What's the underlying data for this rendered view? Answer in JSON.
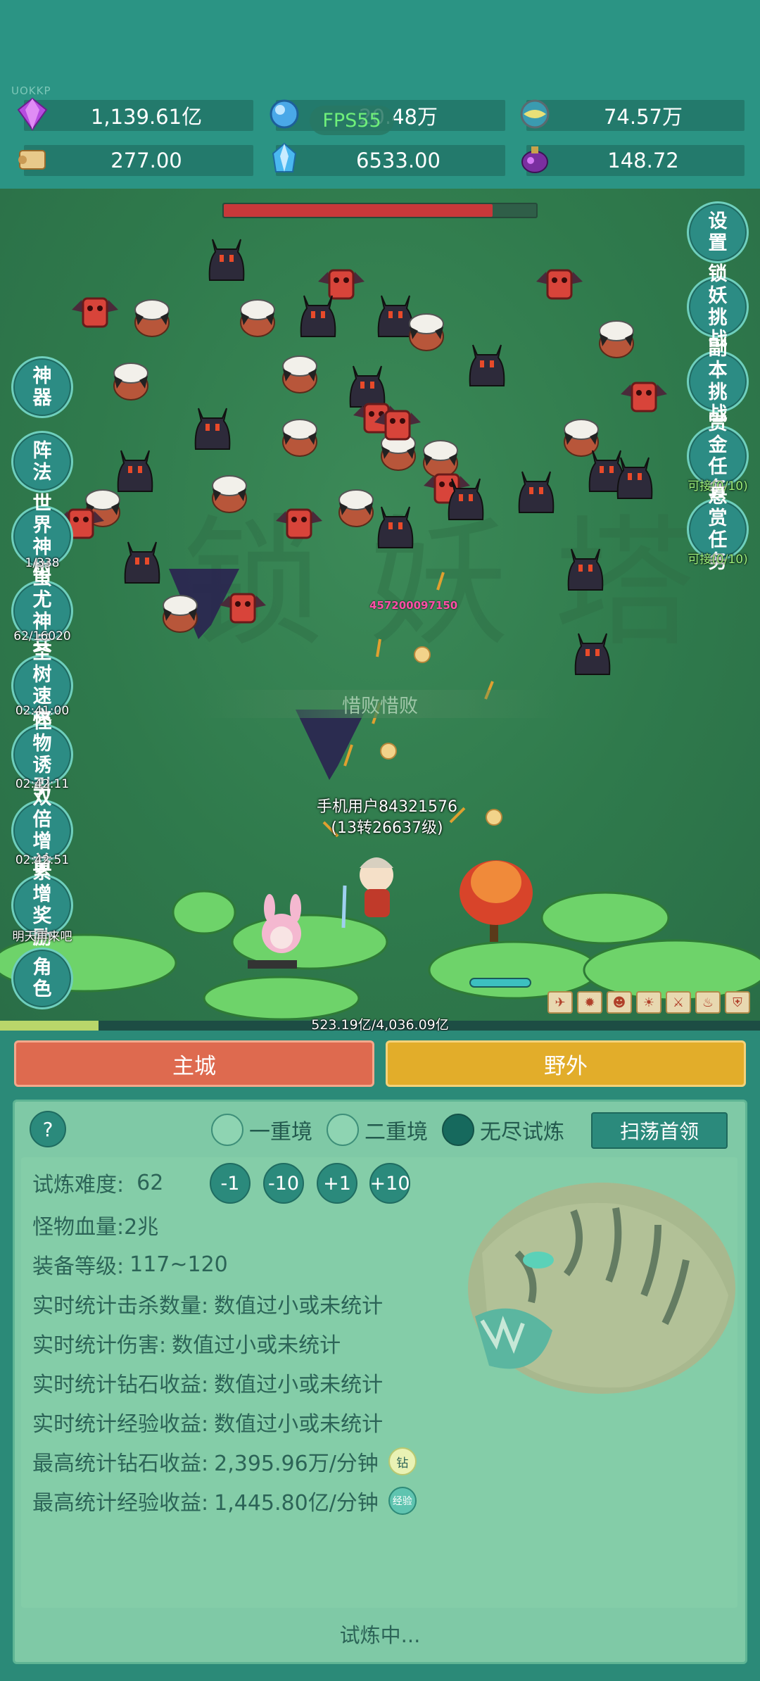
{
  "corner_tag": "UOKKP",
  "fps_label": "FPS55",
  "resources": [
    {
      "icon": "purple-gem-icon",
      "value": "1,139.61亿"
    },
    {
      "icon": "blue-orb-icon",
      "value": "20.48万"
    },
    {
      "icon": "globe-orb-icon",
      "value": "74.57万"
    },
    {
      "icon": "scroll-icon",
      "value": "277.00"
    },
    {
      "icon": "blue-crystal-icon",
      "value": "6533.00"
    },
    {
      "icon": "purple-potion-icon",
      "value": "148.72"
    }
  ],
  "boss_hp_fraction": 0.86,
  "left_buttons": [
    {
      "label": "神器",
      "sub": ""
    },
    {
      "label": "阵法",
      "sub": ""
    },
    {
      "label": "世界神树",
      "sub": "1/338"
    },
    {
      "label": "蚩尤神兵",
      "sub": "62/16020"
    },
    {
      "label": "圣树速充",
      "sub": "02:41:00"
    },
    {
      "label": "怪物诱引",
      "sub": "02:42:11"
    },
    {
      "label": "双倍增益",
      "sub": "02:42:51"
    },
    {
      "label": "累增奖励",
      "sub": "明天再来吧"
    },
    {
      "label": "角色",
      "sub": ""
    }
  ],
  "right_buttons": [
    {
      "label": "设置",
      "sub": ""
    },
    {
      "label": "锁妖挑战",
      "sub": ""
    },
    {
      "label": "副本挑战",
      "sub": ""
    },
    {
      "label": "赏金任务",
      "sub": "可接(0/10)"
    },
    {
      "label": "悬赏任务",
      "sub": "可接(0/10)"
    }
  ],
  "damage_number": "457200097150",
  "lose_banner": "惜败惜败",
  "player": {
    "name": "手机用户84321576",
    "level": "(13转26637级)"
  },
  "exp": {
    "text": "523.19亿/4,036.09亿",
    "fraction": 0.13
  },
  "tabs": {
    "main_city": "主城",
    "wild": "野外"
  },
  "panel": {
    "help": "?",
    "modes": [
      {
        "label": "一重境",
        "selected": false
      },
      {
        "label": "二重境",
        "selected": false
      },
      {
        "label": "无尽试炼",
        "selected": true
      }
    ],
    "sweep_button": "扫荡首领",
    "difficulty_label": "试炼难度:",
    "difficulty_value": "62",
    "steppers": [
      "-1",
      "-10",
      "+1",
      "+10"
    ],
    "stats": [
      {
        "label": "怪物血量:",
        "value": "2兆"
      },
      {
        "label": "装备等级:",
        "value": "117~120"
      },
      {
        "label": "实时统计击杀数量:",
        "value": "数值过小或未统计"
      },
      {
        "label": "实时统计伤害:",
        "value": "数值过小或未统计"
      },
      {
        "label": "实时统计钻石收益:",
        "value": "数值过小或未统计"
      },
      {
        "label": "实时统计经验收益:",
        "value": "数值过小或未统计"
      },
      {
        "label": "最高统计钻石收益:",
        "value": "2,395.96万/分钟",
        "badge": "钻"
      },
      {
        "label": "最高统计经验收益:",
        "value": "1,445.80亿/分钟",
        "badge": "经验"
      }
    ],
    "status": "试炼中..."
  },
  "colors": {
    "accent": "#2b8a7c",
    "main_tab": "#de6a4f",
    "wild_tab": "#e2ad2a",
    "hp": "#c8383a"
  }
}
